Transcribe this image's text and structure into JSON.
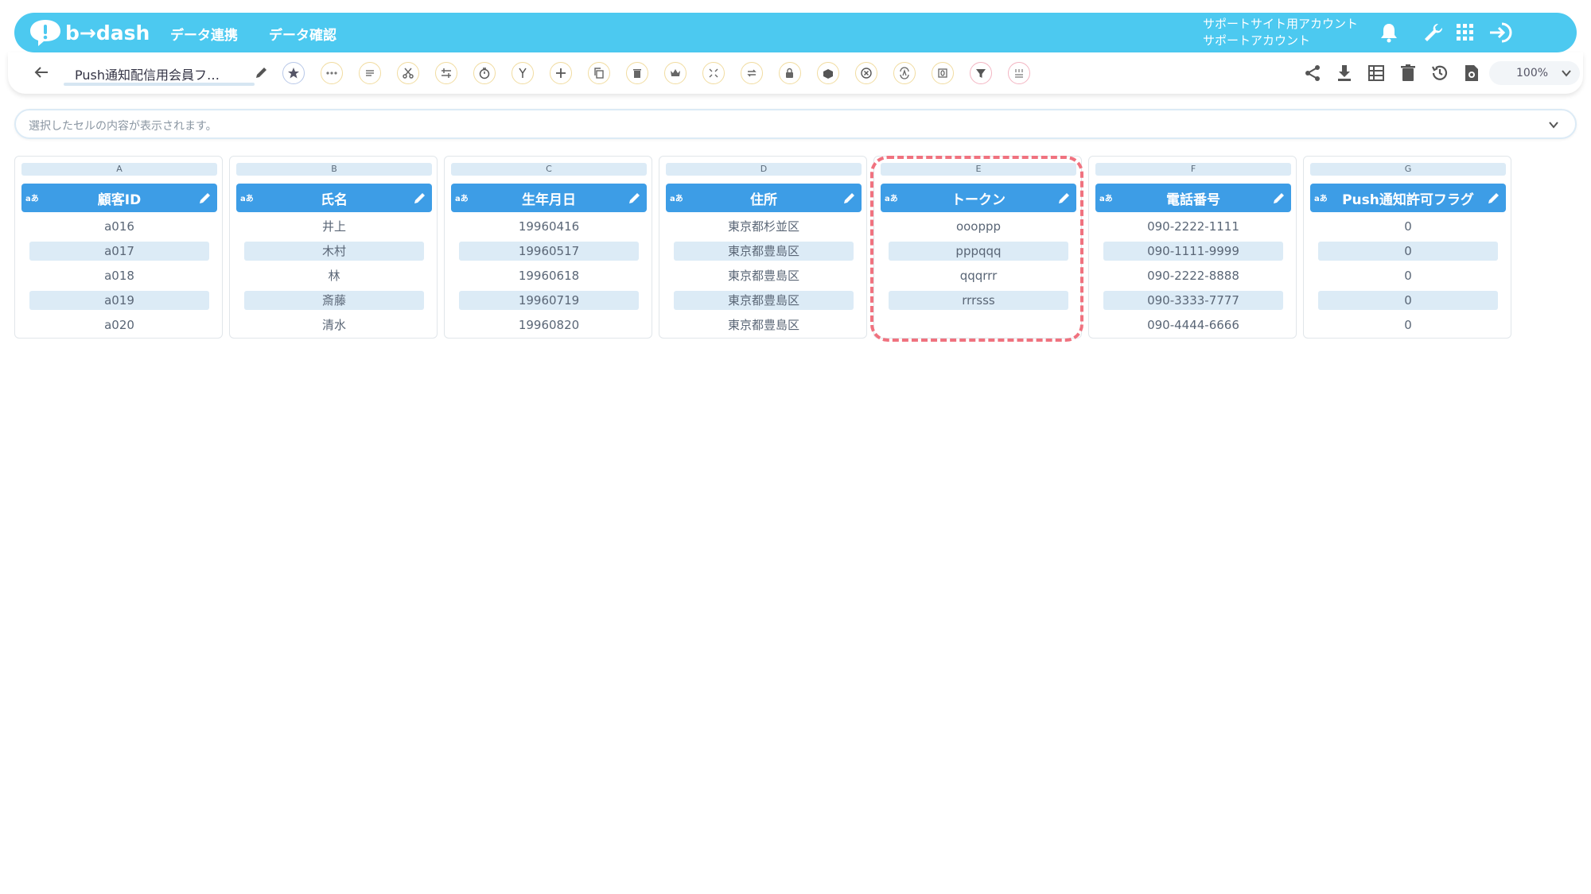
{
  "header": {
    "logo_text": "b→dash",
    "nav": [
      "データ連携",
      "データ確認"
    ],
    "account_line1": "サポートサイト用アカウント",
    "account_line2": "サポートアカウント"
  },
  "toolbar": {
    "sheet_name": "Push通知配信用会員フ…",
    "zoom": "100%"
  },
  "cellbar": {
    "placeholder": "選択したセルの内容が表示されます。"
  },
  "type_badge": "aあ",
  "columns": [
    {
      "letter": "A",
      "header": "顧客ID",
      "cells": [
        "a016",
        "a017",
        "a018",
        "a019",
        "a020"
      ]
    },
    {
      "letter": "B",
      "header": "氏名",
      "cells": [
        "井上",
        "木村",
        "林",
        "斎藤",
        "清水"
      ]
    },
    {
      "letter": "C",
      "header": "生年月日",
      "cells": [
        "19960416",
        "19960517",
        "19960618",
        "19960719",
        "19960820"
      ]
    },
    {
      "letter": "D",
      "header": "住所",
      "cells": [
        "東京都杉並区",
        "東京都豊島区",
        "東京都豊島区",
        "東京都豊島区",
        "東京都豊島区"
      ]
    },
    {
      "letter": "E",
      "header": "トークン",
      "cells": [
        "oooppp",
        "pppqqq",
        "qqqrrr",
        "rrrsss",
        ""
      ]
    },
    {
      "letter": "F",
      "header": "電話番号",
      "cells": [
        "090-2222-1111",
        "090-1111-9999",
        "090-2222-8888",
        "090-3333-7777",
        "090-4444-6666"
      ]
    },
    {
      "letter": "G",
      "header": "Push通知許可フラグ",
      "cells": [
        "0",
        "0",
        "0",
        "0",
        "0"
      ]
    }
  ],
  "colors": {
    "topbar": "#4cc9f0",
    "column_header": "#3d9de6",
    "alt_row": "#dcebf6",
    "highlight": "#f0727f"
  }
}
